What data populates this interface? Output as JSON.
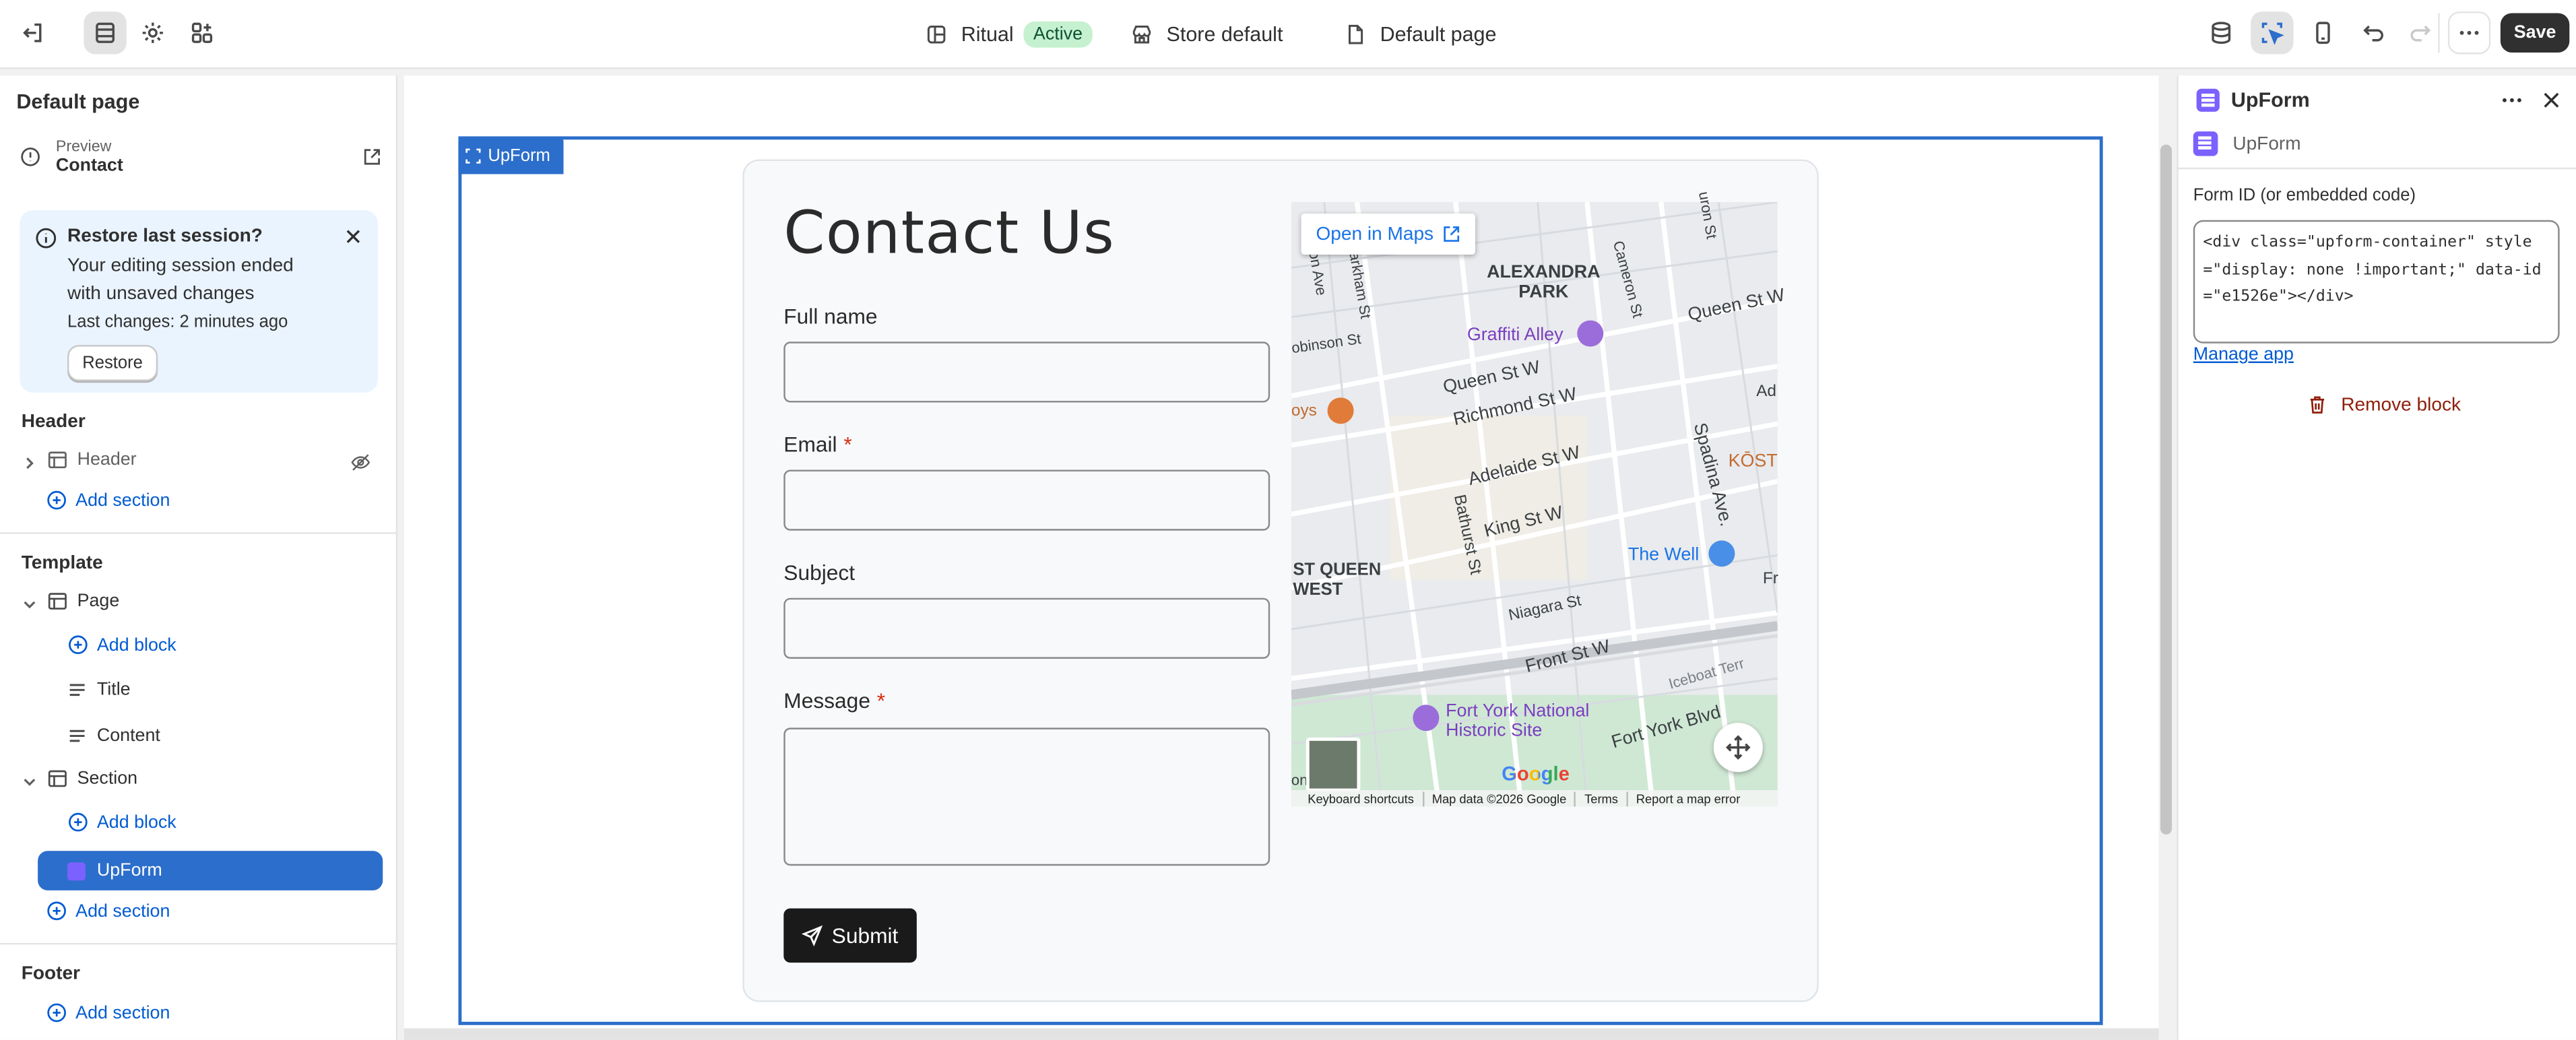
{
  "topbar": {
    "theme_name": "Ritual",
    "theme_status": "Active",
    "store": "Store default",
    "page": "Default page",
    "save_label": "Save"
  },
  "left": {
    "title": "Default page",
    "preview_label": "Preview",
    "preview_page": "Contact",
    "restore": {
      "title": "Restore last session?",
      "message": "Your editing session ended with unsaved changes",
      "last_changes": "Last changes: 2 minutes ago",
      "button": "Restore"
    },
    "header_section": "Header",
    "header_item": "Header",
    "add_section": "Add section",
    "template_section": "Template",
    "page_item": "Page",
    "add_block": "Add block",
    "title_item": "Title",
    "content_item": "Content",
    "section_item": "Section",
    "upform_item": "UpForm",
    "footer_section": "Footer"
  },
  "canvas": {
    "selected_tag": "UpForm",
    "form": {
      "title": "Contact Us",
      "full_name_label": "Full name",
      "email_label": "Email",
      "subject_label": "Subject",
      "message_label": "Message",
      "required_mark": "*",
      "submit_label": "Submit"
    },
    "map": {
      "open_in_maps": "Open in Maps",
      "google": "Google",
      "footer": [
        "Keyboard shortcuts",
        "Map data ©2026 Google",
        "Terms",
        "Report a map error"
      ],
      "labels": {
        "alexandra_park": "ALEXANDRA\nPARK",
        "graffiti_alley": "Graffiti Alley",
        "queen_st_w": "Queen St W",
        "queen_st_w2": "Queen St W",
        "richmond_st_w": "Richmond St W",
        "adelaide_st_w": "Adelaide St W",
        "king_st_w": "King St W",
        "spadina_ave": "Spadina Ave.",
        "kost": "KŌST",
        "the_well": "The Well",
        "bathurst_st": "Bathurst St",
        "st_queen_west": "ST QUEEN\nWEST",
        "niagara_st": "Niagara St",
        "front_st_w": "Front St W",
        "iceboat_terr": "Iceboat Terr",
        "fort_york": "Fort York National\nHistoric Site",
        "fort_york_blvd": "Fort York Blvd",
        "markham_st": "Markham St",
        "cameron_st": "Cameron St",
        "robinson_st": "obinson St",
        "oys": "oys",
        "ad": "Ad",
        "fr": "Fr",
        "ton_ave": "ton Ave",
        "uron_st": "uron St",
        "ont": "ont"
      }
    }
  },
  "right": {
    "title": "UpForm",
    "app_name": "UpForm",
    "field_label": "Form ID (or embedded code)",
    "field_value": "<div class=\"upform-container\" style=\"display: none !important;\" data-id=\"e1526e\"></div>",
    "manage_app": "Manage app",
    "remove_block": "Remove block"
  },
  "colors": {
    "accent": "#2c6ecb",
    "link": "#005bd3",
    "active_badge_bg": "#c6f1d0",
    "danger": "#8e1f0b",
    "app_icon": "#7b61ff"
  },
  "icons": [
    "exit-icon",
    "sections-icon",
    "settings-icon",
    "apps-icon",
    "theme-icon",
    "store-icon",
    "page-icon",
    "database-icon",
    "inspector-icon",
    "mobile-icon",
    "undo-icon",
    "redo-icon",
    "more-icon"
  ]
}
